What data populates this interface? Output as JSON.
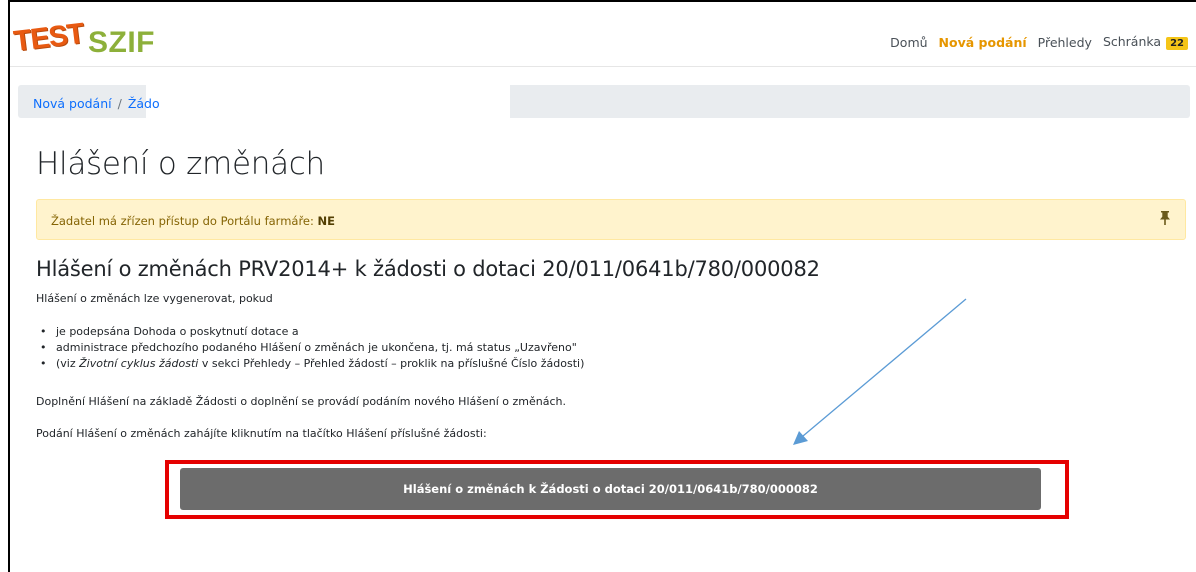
{
  "logo": {
    "test": "TEST",
    "brand": "SZIF"
  },
  "nav": {
    "items": [
      "Domů",
      "Nová podání",
      "Přehledy",
      "Schránka"
    ],
    "active": "Nová podání",
    "inbox_count": "22"
  },
  "breadcrumb": {
    "first": "Nová podání",
    "separator": "/",
    "second": "Žádo"
  },
  "page": {
    "title": "Hlášení o změnách"
  },
  "alert": {
    "text": "Žadatel má zřízen přístup do Portálu farmáře:",
    "value": "NE"
  },
  "section": {
    "title": "Hlášení o změnách PRV2014+ k žádosti o dotaci 20/011/0641b/780/000082",
    "intro": "Hlášení o změnách lze vygenerovat, pokud",
    "bullet1": "je podepsána Dohoda o poskytnutí dotace a",
    "bullet2": "administrace předchozího podaného Hlášení o změnách je ukončena, tj. má status „Uzavřeno\"",
    "bullet2_note_pre": "(viz",
    "bullet2_note_em": "Životní cyklus žádosti",
    "bullet2_note_post": "v sekci Přehledy – Přehled žádostí – proklik na příslušné Číslo žádosti)",
    "para1": "Doplnění Hlášení na základě Žádosti o doplnění se provádí podáním nového Hlášení o změnách.",
    "para2": "Podání Hlášení o změnách zahájíte kliknutím na tlačítko Hlášení příslušné žádosti:",
    "button_label": "Hlášení o změnách k Žádosti o dotaci 20/011/0641b/780/000082"
  },
  "colors": {
    "logo_test": "#e85a12",
    "logo_szif": "#8db03a",
    "nav_active": "#e69600",
    "badge": "#f5c518",
    "alert_bg": "#fff3cd",
    "button_bg": "#6c6c6c",
    "highlight_box": "#e50000",
    "arrow": "#5b9bd5"
  },
  "icons": {
    "pin": "pin-icon"
  }
}
